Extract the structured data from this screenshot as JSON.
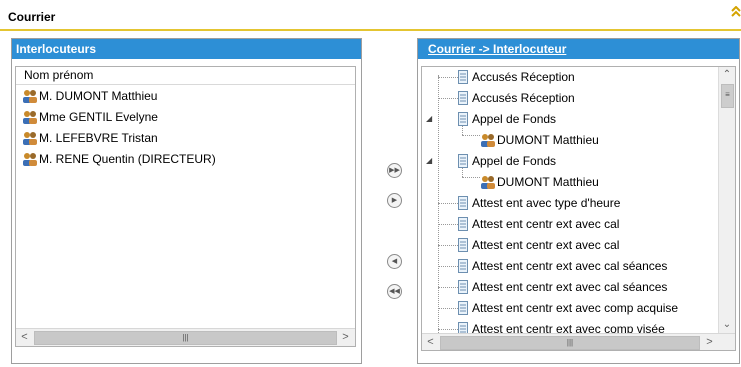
{
  "section": {
    "title": "Courrier",
    "collapse_icon": "double-chevron-up-icon"
  },
  "left_panel": {
    "title": "Interlocuteurs",
    "column_header": "Nom prénom",
    "items": [
      {
        "label": "M. DUMONT Matthieu"
      },
      {
        "label": "Mme GENTIL Evelyne"
      },
      {
        "label": "M. LEFEBVRE Tristan"
      },
      {
        "label": "M. RENE Quentin (DIRECTEUR)"
      }
    ]
  },
  "transfer_buttons": {
    "move_all_right": "double-right-arrow-icon",
    "move_right": "right-arrow-icon",
    "move_left": "left-arrow-icon",
    "move_all_left": "double-left-arrow-icon"
  },
  "right_panel": {
    "title": "Courrier -> Interlocuteur",
    "tree": [
      {
        "label": "Accusés Réception",
        "level": 0,
        "expanded": false,
        "icon": "document-icon"
      },
      {
        "label": "Accusés Réception",
        "level": 0,
        "expanded": false,
        "icon": "document-icon"
      },
      {
        "label": "Appel de Fonds",
        "level": 0,
        "expanded": true,
        "icon": "document-icon"
      },
      {
        "label": "DUMONT Matthieu",
        "level": 1,
        "icon": "person-icon"
      },
      {
        "label": "Appel de Fonds",
        "level": 0,
        "expanded": true,
        "icon": "document-icon"
      },
      {
        "label": "DUMONT Matthieu",
        "level": 1,
        "icon": "person-icon"
      },
      {
        "label": "Attest ent avec type d'heure",
        "level": 0,
        "icon": "document-icon"
      },
      {
        "label": "Attest ent centr ext avec cal",
        "level": 0,
        "icon": "document-icon"
      },
      {
        "label": "Attest ent centr ext avec cal",
        "level": 0,
        "icon": "document-icon"
      },
      {
        "label": "Attest ent centr ext avec cal séances",
        "level": 0,
        "icon": "document-icon"
      },
      {
        "label": "Attest ent centr ext avec cal séances",
        "level": 0,
        "icon": "document-icon"
      },
      {
        "label": "Attest ent centr ext avec comp acquise",
        "level": 0,
        "icon": "document-icon"
      },
      {
        "label": "Attest ent centr ext avec comp visée",
        "level": 0,
        "icon": "document-icon"
      }
    ]
  },
  "colors": {
    "panel_header": "#2d8fd6",
    "accent_rule": "#e4c531"
  }
}
